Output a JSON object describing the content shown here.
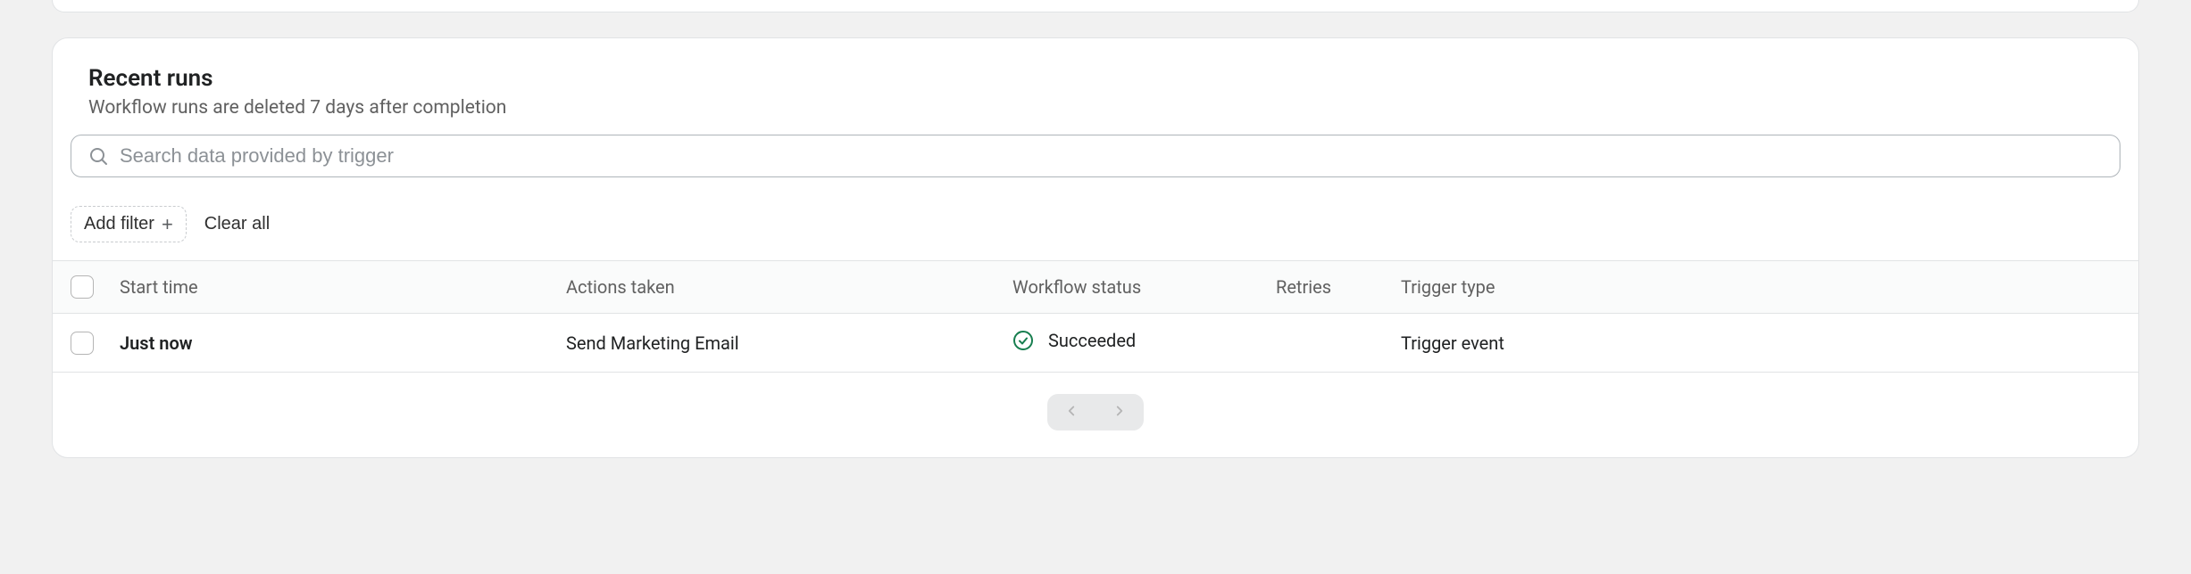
{
  "header": {
    "title": "Recent runs",
    "subtitle": "Workflow runs are deleted 7 days after completion"
  },
  "search": {
    "placeholder": "Search data provided by trigger",
    "value": ""
  },
  "filters": {
    "add_label": "Add filter",
    "clear_label": "Clear all"
  },
  "columns": {
    "start": "Start time",
    "actions": "Actions taken",
    "status": "Workflow status",
    "retries": "Retries",
    "trigger": "Trigger type"
  },
  "rows": [
    {
      "start": "Just now",
      "actions": "Send Marketing Email",
      "status": "Succeeded",
      "retries": "",
      "trigger": "Trigger event"
    }
  ]
}
